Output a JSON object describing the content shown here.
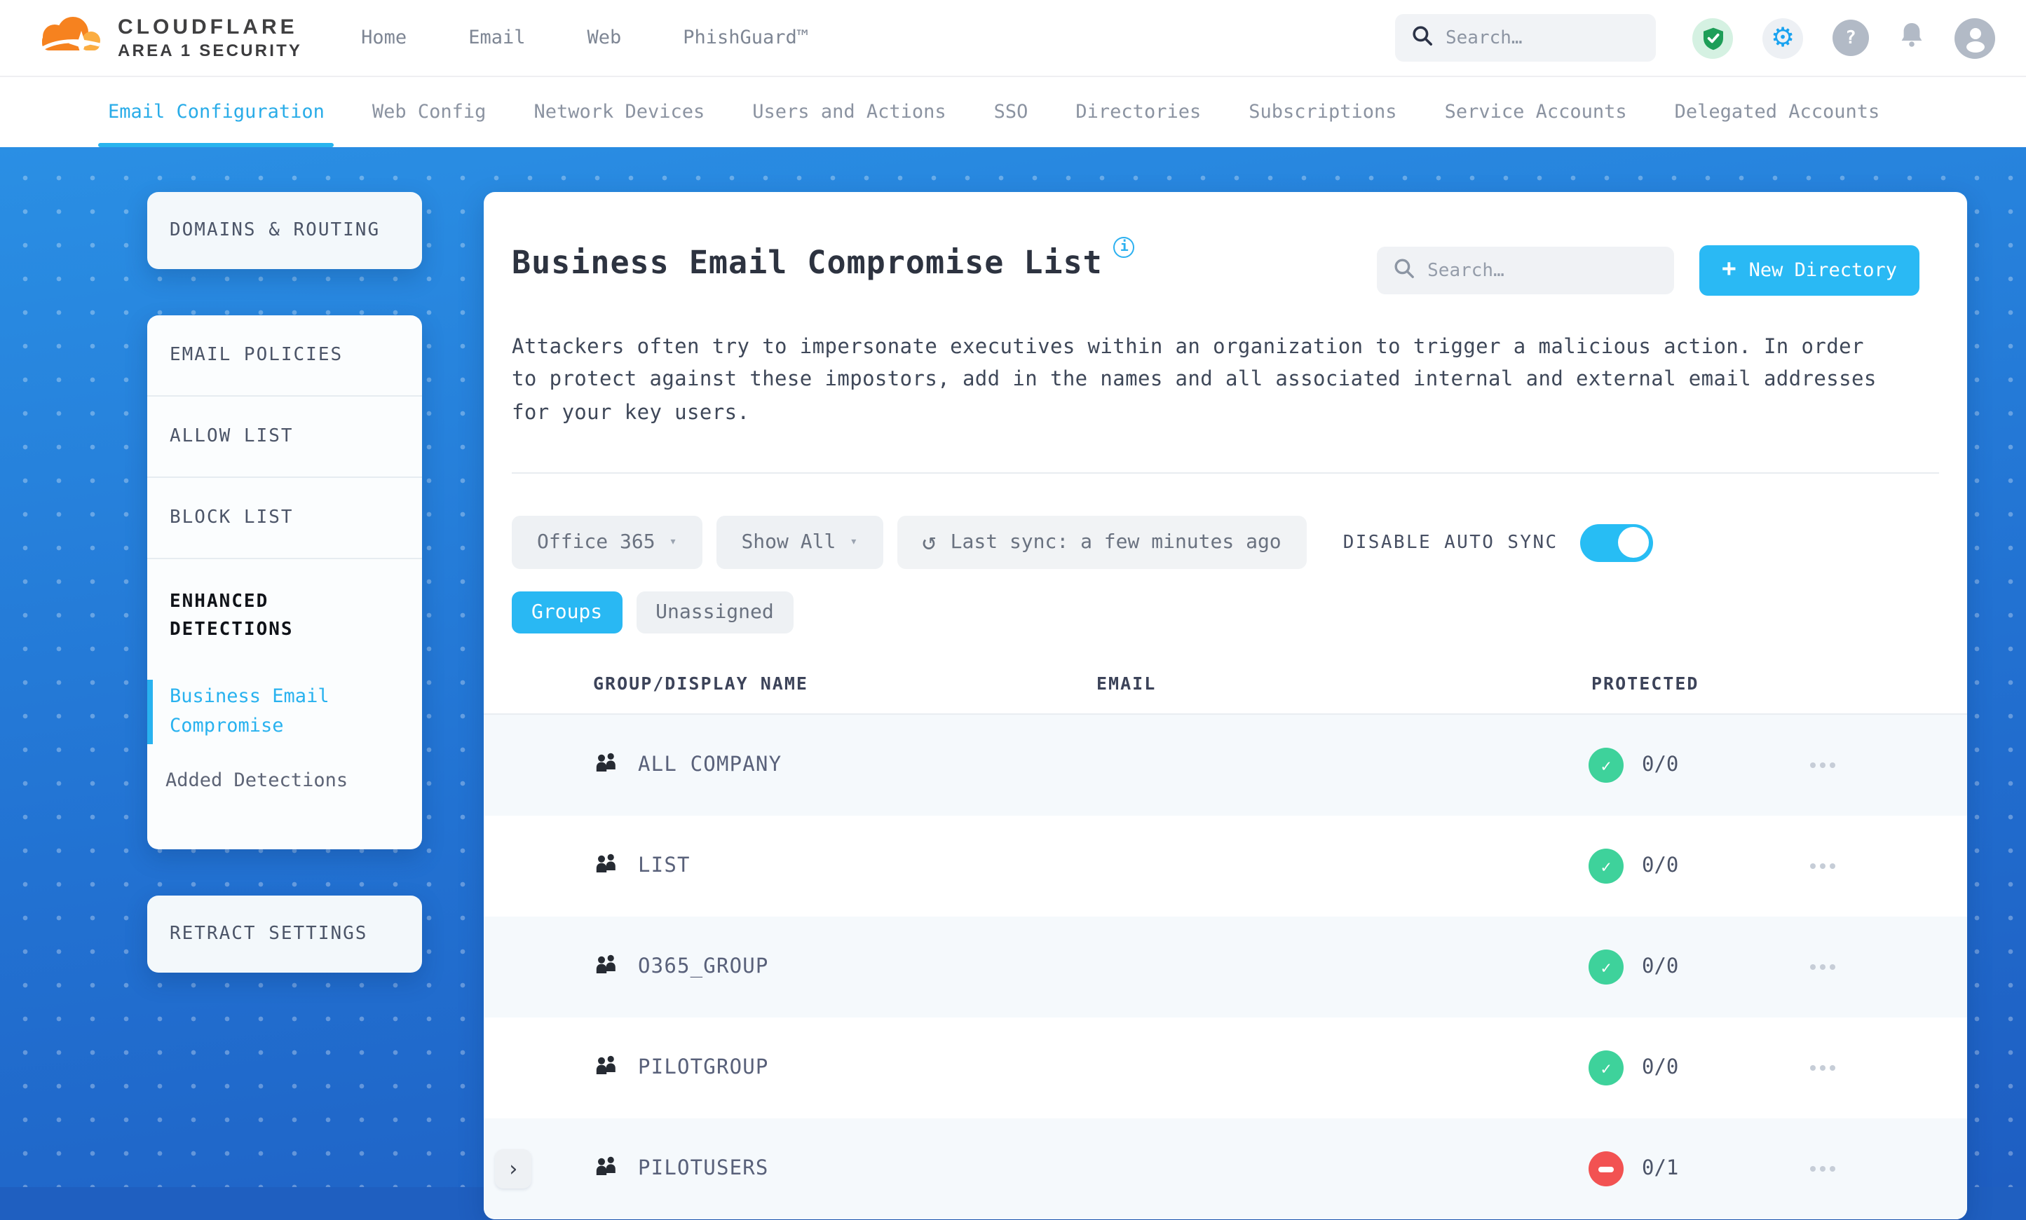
{
  "topbar": {
    "brand_line1": "CLOUDFLARE",
    "brand_line2": "AREA 1 SECURITY",
    "nav": [
      {
        "label": "Home"
      },
      {
        "label": "Email"
      },
      {
        "label": "Web"
      },
      {
        "label": "PhishGuard™"
      }
    ],
    "search_placeholder": "Search…"
  },
  "tabs": {
    "items": [
      {
        "label": "Email Configuration",
        "active": true
      },
      {
        "label": "Web Config",
        "active": false
      },
      {
        "label": "Network Devices",
        "active": false
      },
      {
        "label": "Users and Actions",
        "active": false
      },
      {
        "label": "SSO",
        "active": false
      },
      {
        "label": "Directories",
        "active": false
      },
      {
        "label": "Subscriptions",
        "active": false
      },
      {
        "label": "Service Accounts",
        "active": false
      },
      {
        "label": "Delegated Accounts",
        "active": false
      }
    ]
  },
  "sidebar": {
    "domains_routing": "DOMAINS & ROUTING",
    "email_policies": "EMAIL POLICIES",
    "allow_list": "ALLOW LIST",
    "block_list": "BLOCK LIST",
    "enhanced_detections": "ENHANCED DETECTIONS",
    "business_email_compromise": "Business Email Compromise",
    "added_detections": "Added Detections",
    "retract_settings": "RETRACT SETTINGS"
  },
  "main": {
    "title": "Business Email Compromise List",
    "search_placeholder": "Search…",
    "new_directory_label": "New Directory",
    "description": "Attackers often try to impersonate executives within an organization to trigger a malicious action. In order to protect against these impostors, add in the names and all associated internal and external email addresses for your key users.",
    "filters": {
      "directory_select": "Office 365",
      "show_select": "Show All",
      "last_sync": "Last sync: a few minutes ago",
      "auto_sync_label": "DISABLE AUTO SYNC",
      "auto_sync_on": true
    },
    "view_chips": [
      {
        "label": "Groups",
        "active": true
      },
      {
        "label": "Unassigned",
        "active": false
      }
    ],
    "table": {
      "columns": [
        "GROUP/DISPLAY NAME",
        "EMAIL",
        "PROTECTED"
      ],
      "rows": [
        {
          "name": "ALL COMPANY",
          "email": "",
          "protected_count": "0/0",
          "status": "protected",
          "expandable": false
        },
        {
          "name": "LIST",
          "email": "",
          "protected_count": "0/0",
          "status": "protected",
          "expandable": false
        },
        {
          "name": "O365_GROUP",
          "email": "",
          "protected_count": "0/0",
          "status": "protected",
          "expandable": false
        },
        {
          "name": "PILOTGROUP",
          "email": "",
          "protected_count": "0/0",
          "status": "protected",
          "expandable": false
        },
        {
          "name": "PILOTUSERS",
          "email": "",
          "protected_count": "0/1",
          "status": "unprotected",
          "expandable": true
        }
      ]
    }
  },
  "icons": {
    "info_glyph": "i",
    "plus_glyph": "+",
    "caret_glyph": "▾",
    "refresh_glyph": "↺",
    "check_glyph": "✓",
    "chevron_glyph": "›",
    "gear_glyph": "⚙",
    "question_glyph": "?"
  },
  "colors": {
    "accent_cyan": "#29b8f3",
    "tab_active": "#29ace8",
    "protected_green": "#3ed29b",
    "unprotected_red": "#f25252",
    "background_blue_top": "#2a8fe4",
    "background_blue_bottom": "#1e5ec2"
  }
}
